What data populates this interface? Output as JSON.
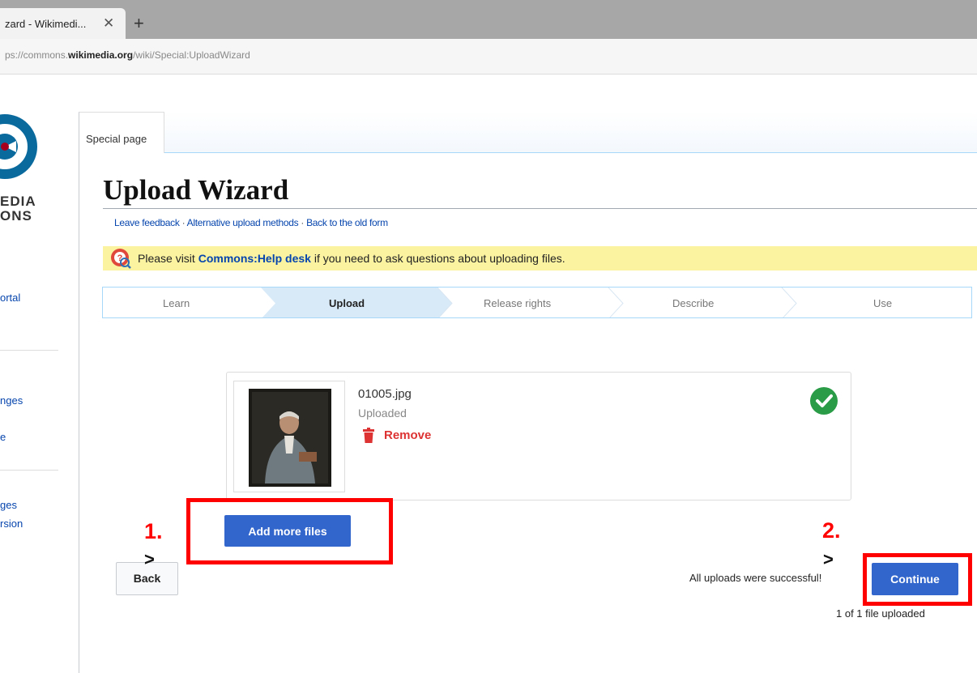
{
  "browser": {
    "tab_title": "zard - Wikimedi...",
    "tab_close": "✕",
    "new_tab": "+",
    "url_prefix": "ps://commons.",
    "url_domain": "wikimedia.org",
    "url_path": "/wiki/Special:UploadWizard"
  },
  "sidebar": {
    "logo_text_line1": "EDIA",
    "logo_text_line2": "ONS",
    "items": [
      "ortal",
      "nges",
      "e",
      "ges",
      "rsion"
    ]
  },
  "page": {
    "special_tab": "Special page",
    "title": "Upload Wizard",
    "links": [
      "Leave feedback",
      "Alternative upload methods",
      "Back to the old form"
    ],
    "link_separator": "·",
    "notice": {
      "prefix": "Please visit ",
      "link": "Commons:Help desk",
      "suffix": " if you need to ask questions about uploading files."
    },
    "steps": [
      {
        "label": "Learn",
        "active": false
      },
      {
        "label": "Upload",
        "active": true
      },
      {
        "label": "Release rights",
        "active": false
      },
      {
        "label": "Describe",
        "active": false
      },
      {
        "label": "Use",
        "active": false
      }
    ]
  },
  "file": {
    "name": "01005.jpg",
    "status": "Uploaded",
    "remove_label": "Remove",
    "upload_progress": 1.0
  },
  "actions": {
    "add_more_label": "Add more files",
    "back_label": "Back",
    "continue_label": "Continue",
    "success_message": "All uploads were successful!",
    "progress_message": "1 of 1 file uploaded"
  },
  "annotations": {
    "step1": "1.",
    "step2": "2.",
    "caret": ">",
    "highlight_color": "#ff0000"
  },
  "colors": {
    "primary_button": "#3366cc",
    "link": "#0645ad",
    "notice_bg": "#fbf3a0",
    "remove": "#dd3333",
    "success_check": "#2a9b47"
  }
}
